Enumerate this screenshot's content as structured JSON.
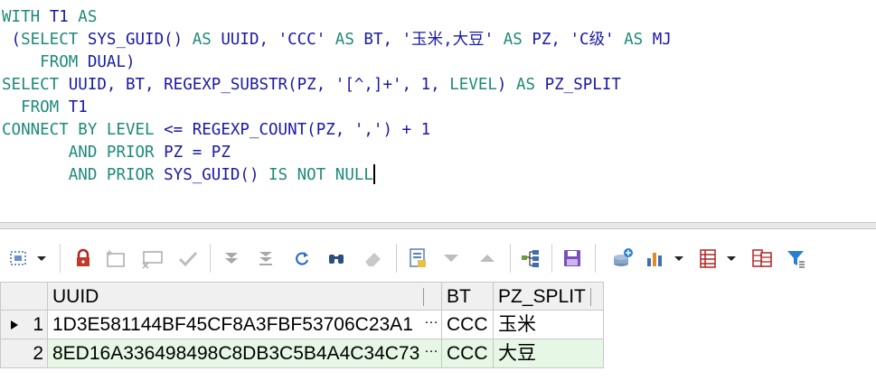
{
  "editor": {
    "lines": [
      [
        {
          "t": "WITH ",
          "c": "kw"
        },
        {
          "t": "T1 ",
          "c": "id"
        },
        {
          "t": "AS",
          "c": "kw"
        }
      ],
      [
        {
          "t": " (",
          "c": "id"
        },
        {
          "t": "SELECT ",
          "c": "kw"
        },
        {
          "t": "SYS_GUID() ",
          "c": "id"
        },
        {
          "t": "AS ",
          "c": "kw"
        },
        {
          "t": "UUID, ",
          "c": "id"
        },
        {
          "t": "'CCC' ",
          "c": "str"
        },
        {
          "t": "AS ",
          "c": "kw"
        },
        {
          "t": "BT, ",
          "c": "id"
        },
        {
          "t": "'玉米,大豆' ",
          "c": "str"
        },
        {
          "t": "AS ",
          "c": "kw"
        },
        {
          "t": "PZ, ",
          "c": "id"
        },
        {
          "t": "'C级' ",
          "c": "str"
        },
        {
          "t": "AS ",
          "c": "kw"
        },
        {
          "t": "MJ",
          "c": "id"
        }
      ],
      [
        {
          "t": "    ",
          "c": "id"
        },
        {
          "t": "FROM ",
          "c": "kw"
        },
        {
          "t": "DUAL)",
          "c": "id"
        }
      ],
      [
        {
          "t": "SELECT ",
          "c": "kw"
        },
        {
          "t": "UUID, BT, REGEXP_SUBSTR(PZ, ",
          "c": "id"
        },
        {
          "t": "'[^,]+'",
          "c": "str"
        },
        {
          "t": ", 1, ",
          "c": "id"
        },
        {
          "t": "LEVEL",
          "c": "kw"
        },
        {
          "t": ") ",
          "c": "id"
        },
        {
          "t": "AS ",
          "c": "kw"
        },
        {
          "t": "PZ_SPLIT",
          "c": "id"
        }
      ],
      [
        {
          "t": "  ",
          "c": "id"
        },
        {
          "t": "FROM ",
          "c": "kw"
        },
        {
          "t": "T1",
          "c": "id"
        }
      ],
      [
        {
          "t": "CONNECT BY LEVEL ",
          "c": "kw"
        },
        {
          "t": "<= REGEXP_COUNT(PZ, ",
          "c": "id"
        },
        {
          "t": "','",
          "c": "str"
        },
        {
          "t": ") + 1",
          "c": "id"
        }
      ],
      [
        {
          "t": "       ",
          "c": "id"
        },
        {
          "t": "AND PRIOR ",
          "c": "kw"
        },
        {
          "t": "PZ = PZ",
          "c": "id"
        }
      ],
      [
        {
          "t": "       ",
          "c": "id"
        },
        {
          "t": "AND PRIOR ",
          "c": "kw"
        },
        {
          "t": "SYS_GUID() ",
          "c": "id"
        },
        {
          "t": "IS NOT NULL",
          "c": "kw"
        }
      ]
    ]
  },
  "toolbar": {
    "icons": [
      "select-all-icon",
      "dropdown-arrow-icon",
      "lock-icon",
      "insert-record-icon",
      "delete-record-icon",
      "post-edit-icon",
      "fetch-next-page-icon",
      "fetch-last-page-icon",
      "refresh-icon",
      "find-icon",
      "clear-icon",
      "single-record-view-icon",
      "filter-down-icon",
      "filter-up-icon",
      "query-by-example-icon",
      "save-icon",
      "export-icon",
      "chart-icon",
      "chart-dropdown-icon",
      "grid-icon",
      "grid-dropdown-icon",
      "columns-icon",
      "filter-icon"
    ]
  },
  "grid": {
    "columns": [
      "UUID",
      "BT",
      "PZ_SPLIT"
    ],
    "rows": [
      {
        "num": "1",
        "uuid": "1D3E581144BF45CF8A3FBF53706C23A1",
        "bt": "CCC",
        "pz_split": "玉米"
      },
      {
        "num": "2",
        "uuid": "8ED16A336498498C8DB3C5B4A4C34C73",
        "bt": "CCC",
        "pz_split": "大豆"
      }
    ],
    "ellipsis": "…"
  },
  "colors": {
    "keyword": "#1d8a7a",
    "identifier": "#1a1aa6",
    "alt_row": "#e6f7e6"
  }
}
